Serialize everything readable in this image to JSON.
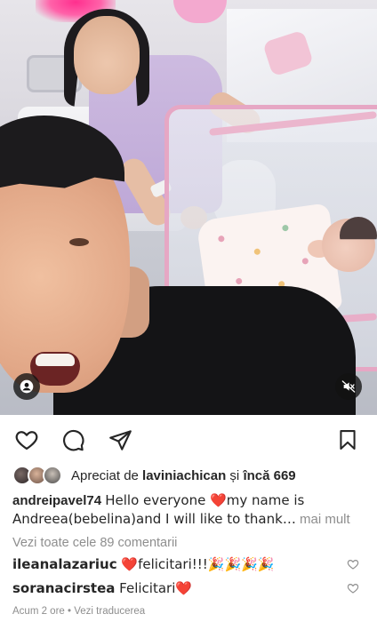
{
  "post": {
    "author": "andreipavel74",
    "caption": "Hello everyone ❤️my name is Andreea(bebelina)and I will like to thank…",
    "more_label": "mai mult"
  },
  "likes": {
    "prefix": "Apreciat de ",
    "user": "laviniachican",
    "middle": " și ",
    "rest": "încă 669"
  },
  "comments": {
    "view_all_label": "Vezi toate cele 89 comentarii",
    "items": [
      {
        "user": "ileanalazariuc",
        "text": "❤️felicitari!!!🎉🎉🎉🎉"
      },
      {
        "user": "soranacirstea",
        "text": "Felicitari❤️"
      }
    ]
  },
  "footer": {
    "time": "Acum 2 ore",
    "separator": " • ",
    "translate_label": "Vezi traducerea"
  },
  "icons": {
    "like": "heart-icon",
    "comment": "comment-icon",
    "share": "send-icon",
    "save": "bookmark-icon",
    "tagged": "person-tag-icon",
    "mute": "speaker-muted-icon"
  },
  "colors": {
    "text": "#262626",
    "muted": "#8e8e8e",
    "heart_red": "#ed2a4a"
  }
}
